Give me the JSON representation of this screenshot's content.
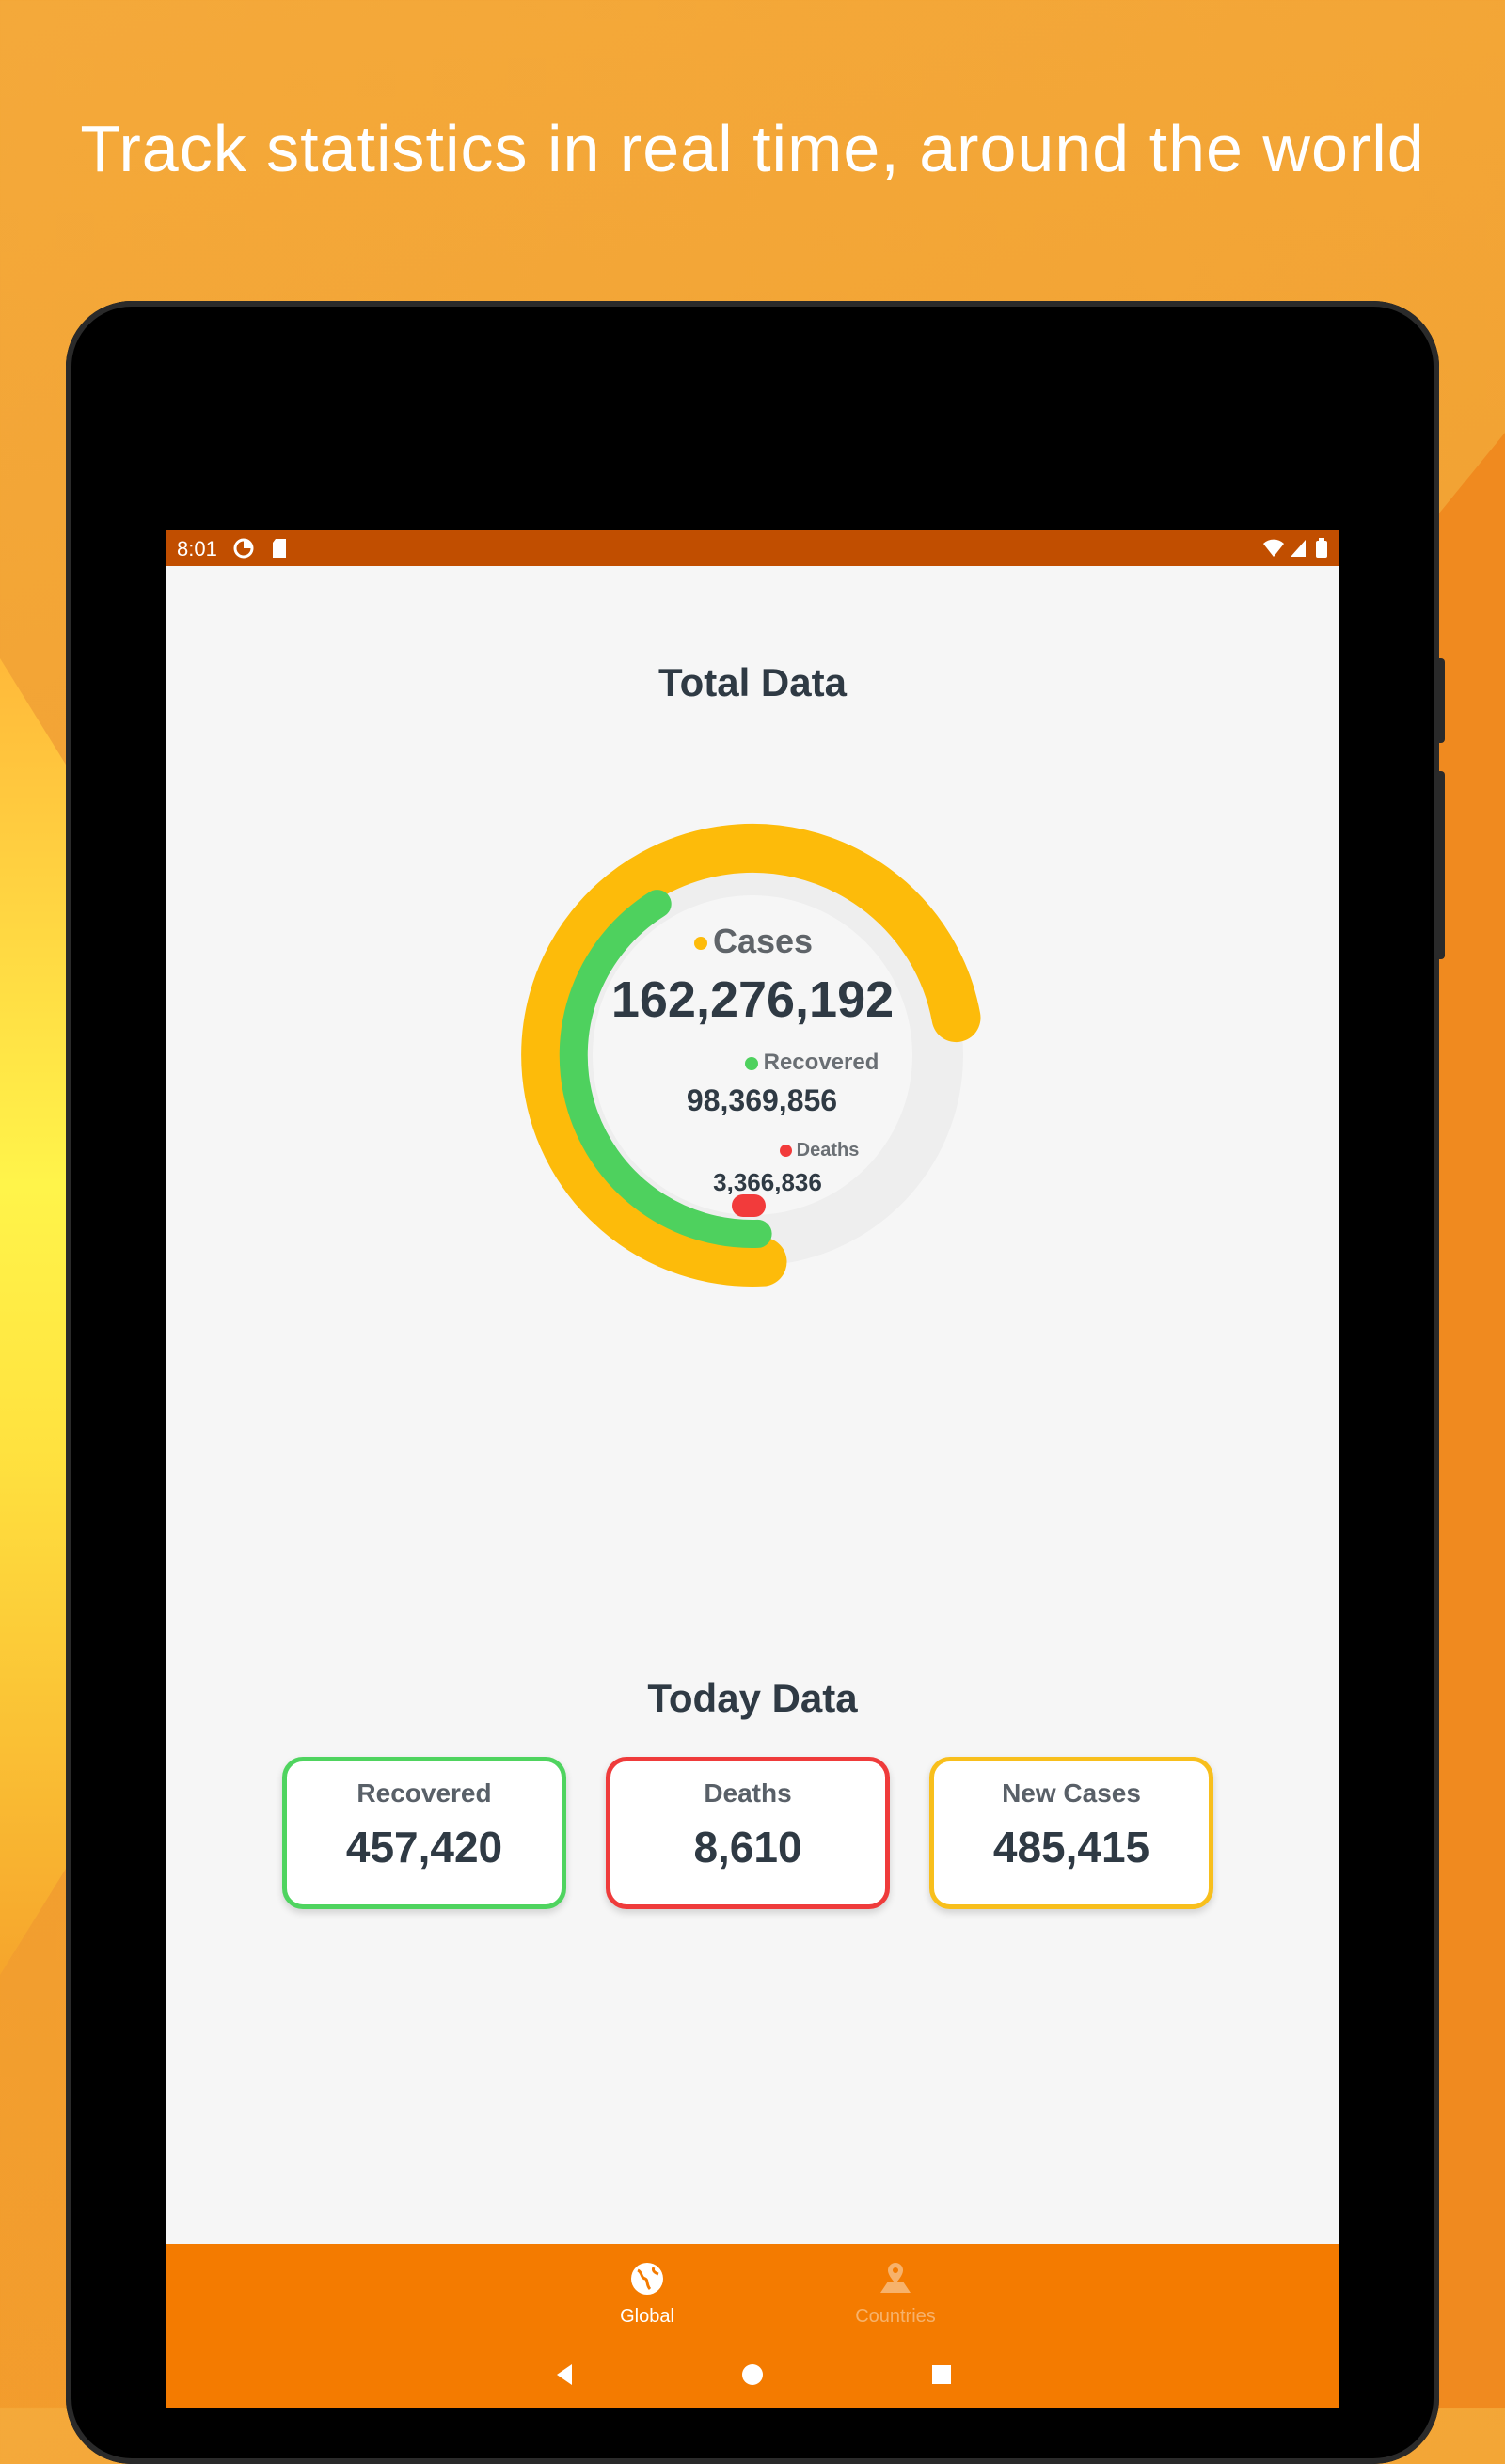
{
  "headline": "Track statistics in real time, around the world",
  "status_bar": {
    "time": "8:01"
  },
  "total": {
    "title": "Total Data",
    "cases_label": "Cases",
    "cases_value": "162,276,192",
    "recovered_label": "Recovered",
    "recovered_value": "98,369,856",
    "deaths_label": "Deaths",
    "deaths_value": "3,366,836"
  },
  "today": {
    "title": "Today Data",
    "cards": [
      {
        "label": "Recovered",
        "value": "457,420",
        "color": "#4fd45f"
      },
      {
        "label": "Deaths",
        "value": "8,610",
        "color": "#ef3b3b"
      },
      {
        "label": "New Cases",
        "value": "485,415",
        "color": "#f8bf1c"
      }
    ]
  },
  "bottom_nav": [
    {
      "label": "Global",
      "icon": "globe-icon",
      "active": true
    },
    {
      "label": "Countries",
      "icon": "map-pin-icon",
      "active": false
    }
  ],
  "colors": {
    "cases": "#fdbb0a",
    "recovered": "#4ed15e",
    "deaths": "#f23b3b",
    "status_bar": "#c14e00",
    "nav_bar": "#f47b00",
    "text_dark": "#2f3a44"
  }
}
